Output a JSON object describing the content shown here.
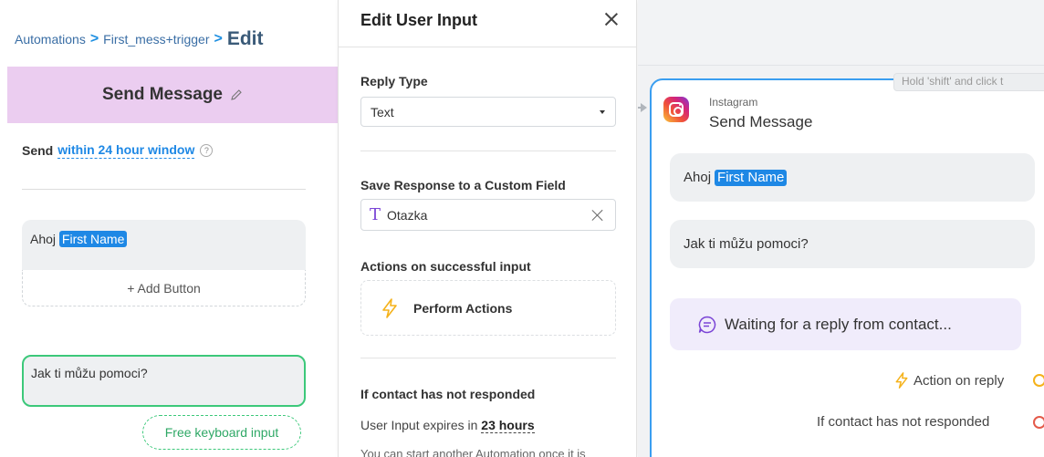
{
  "breadcrumb": {
    "automations": "Automations",
    "flow": "First_mess+trigger",
    "current": "Edit",
    "separator": ">"
  },
  "send_step": {
    "title": "Send Message",
    "send_label": "Send",
    "window_link": "within 24 hour window",
    "help_icon": "?",
    "message_1": {
      "text": "Ahoj",
      "variable": "First Name"
    },
    "add_button": "+ Add Button",
    "message_2": "Jak ti můžu pomoci?",
    "free_input": "Free keyboard input"
  },
  "modal": {
    "title": "Edit User Input",
    "reply_type_label": "Reply Type",
    "reply_type_value": "Text",
    "save_response_label": "Save Response to a Custom Field",
    "custom_field_value": "Otazka",
    "actions_label": "Actions on successful input",
    "perform_actions": "Perform Actions",
    "no_response_label": "If contact has not responded",
    "expires_prefix": "User Input expires in",
    "expires_value": "23 hours",
    "cut_off_text": "You can start another Automation once it is"
  },
  "canvas": {
    "hint": "Hold 'shift' and click t",
    "node": {
      "platform": "Instagram",
      "title": "Send Message",
      "message_1": {
        "text": "Ahoj",
        "variable": "First Name"
      },
      "message_2": "Jak ti můžu pomoci?",
      "waiting": "Waiting for a reply from contact...",
      "action_on_reply": "Action on reply",
      "not_responded": "If contact has not responded"
    }
  },
  "colors": {
    "accent_blue": "#1e88e5",
    "header_purple": "#ebcdf0",
    "green": "#3cc87a",
    "orange": "#f5b21b",
    "red": "#e45a4a",
    "node_border": "#3a9ef0"
  },
  "icons": {
    "pencil": "pencil-icon",
    "close": "close-icon",
    "caret": "chevron-down-icon",
    "text_type": "text-type-icon",
    "bolt": "lightning-icon",
    "instagram": "instagram-icon",
    "chat": "chat-bubble-icon"
  }
}
